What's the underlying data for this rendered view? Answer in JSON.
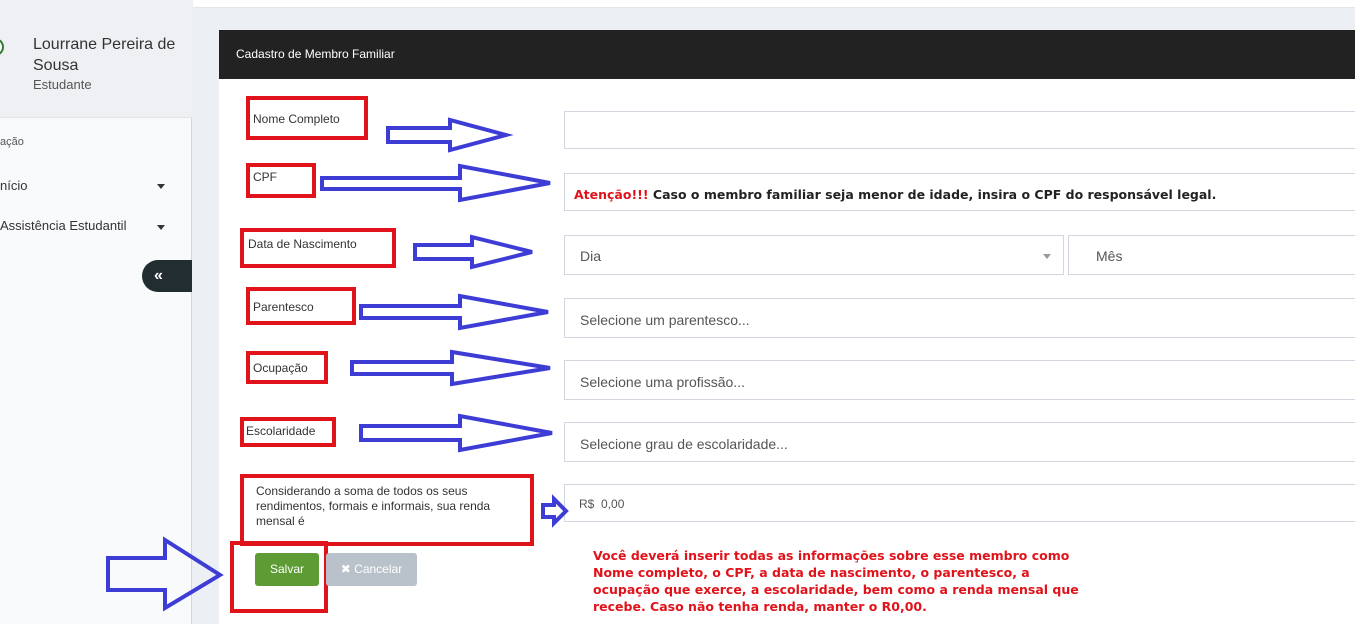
{
  "sidebar": {
    "user_name": "Lourrane Pereira de Sousa",
    "user_role": "Estudante",
    "nav_header": "ação",
    "items": [
      {
        "label": "nício"
      },
      {
        "label": "Assistência Estudantil"
      }
    ],
    "collapse_label": "«"
  },
  "panel": {
    "title": "Cadastro de Membro Familiar"
  },
  "form": {
    "nome_label": "Nome Completo",
    "nome_value": "",
    "cpf_label": "CPF",
    "cpf_warning_prefix": "Atenção!!!",
    "cpf_warning_text": " Caso o membro familiar seja menor de idade, insira o CPF do responsável legal.",
    "nascimento_label": "Data de Nascimento",
    "dia_value": "Dia",
    "mes_value": "Mês",
    "parentesco_label": "Parentesco",
    "parentesco_placeholder": "Selecione um parentesco...",
    "ocupacao_label": "Ocupação",
    "ocupacao_placeholder": "Selecione uma profissão...",
    "escolaridade_label": "Escolaridade",
    "escolaridade_placeholder": "Selecione grau de escolaridade...",
    "renda_label": "Considerando a soma de todos os seus rendimentos, formais e informais, sua renda mensal é",
    "renda_value": "R$  0,00"
  },
  "buttons": {
    "save_label": "Salvar",
    "cancel_label": "✖ Cancelar"
  },
  "note": "Você deverá inserir todas as informações sobre esse membro como Nome completo, o CPF, a data de nascimento, o parentesco, a ocupação que exerce, a escolaridade, bem como a renda mensal que recebe. Caso não tenha renda, manter o R0,00.",
  "colors": {
    "annotation_red": "#e0131b",
    "annotation_blue": "#3d3dd6",
    "header_dark": "#222222",
    "save_green": "#5d9c35"
  }
}
